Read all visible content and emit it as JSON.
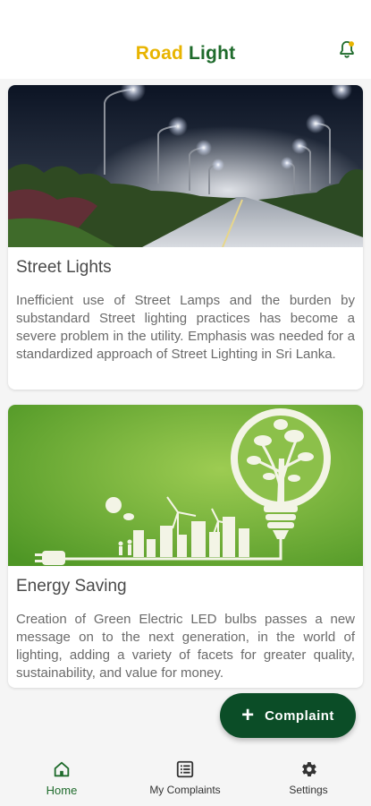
{
  "header": {
    "title_word1": "Road",
    "title_word2": "Light",
    "title_word1_color": "#e8b400",
    "title_word2_color": "#1f6b2c",
    "notification_icon": "bell-icon"
  },
  "cards": [
    {
      "image": "street-lights-photo",
      "title": "Street Lights",
      "text": "Inefficient use of Street Lamps and the burden by substandard Street lighting practices has become a severe problem in the utility. Emphasis was needed for a standardized approach of Street Lighting in Sri Lanka."
    },
    {
      "image": "green-bulb-illustration",
      "title": "Energy Saving",
      "text": "Creation of Green Electric LED bulbs passes a new message on to the next generation, in the world of lighting, adding a variety of facets for greater quality, sustainability, and value for money."
    }
  ],
  "fab": {
    "icon": "plus-icon",
    "label": "Complaint",
    "color": "#0b4d27"
  },
  "bottom_nav": {
    "items": [
      {
        "label": "Home",
        "icon": "home-icon",
        "active": true
      },
      {
        "label": "My Complaints",
        "icon": "list-icon",
        "active": false
      },
      {
        "label": "Settings",
        "icon": "gear-icon",
        "active": false
      }
    ],
    "active_color": "#1f6b2c"
  }
}
